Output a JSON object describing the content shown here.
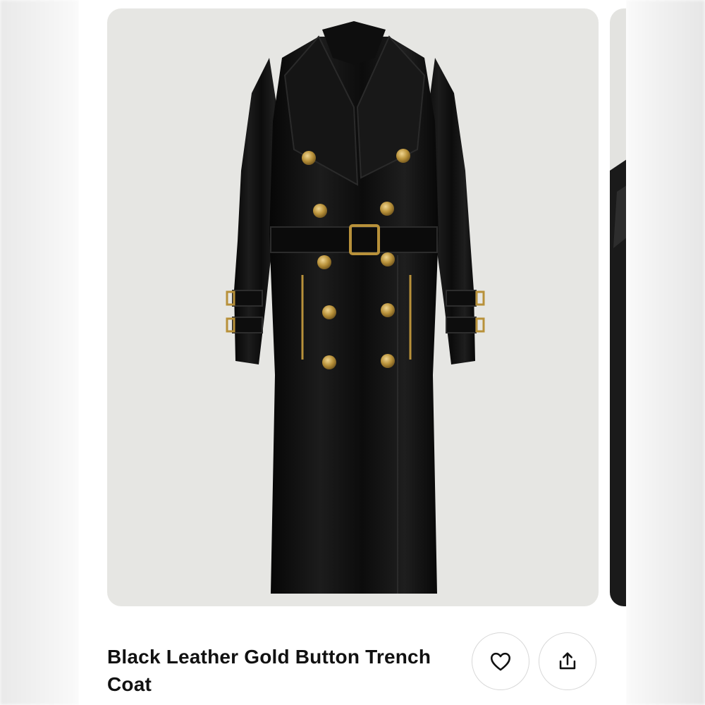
{
  "product": {
    "title": "Black Leather Gold Button Trench Coat",
    "image_description_icon": "coat-product-image"
  },
  "actions": {
    "like_icon": "heart-icon",
    "share_icon": "share-icon"
  },
  "colors": {
    "card_background": "#e6e6e3",
    "coat": "#111111",
    "button_gold": "#b8913a",
    "title_text": "#111111"
  }
}
